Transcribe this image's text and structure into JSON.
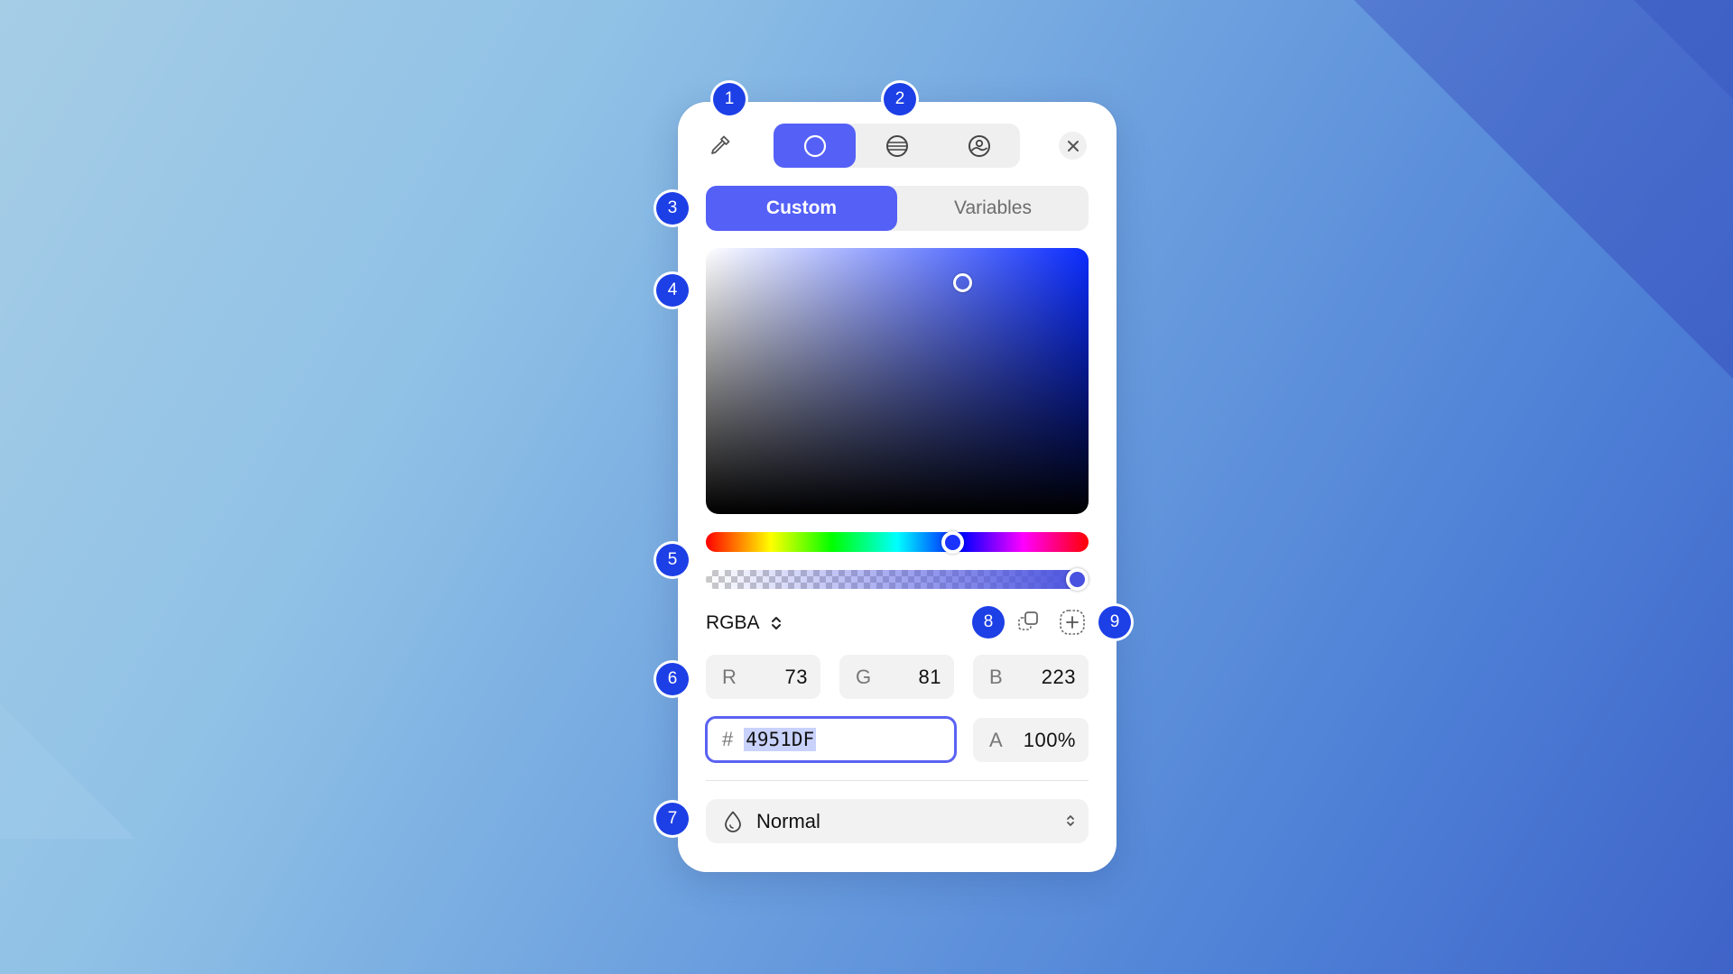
{
  "top_bar": {
    "modes": [
      "solid-color",
      "linear-gradient",
      "image-fill"
    ],
    "active_mode": "solid-color"
  },
  "tabs": {
    "custom": "Custom",
    "variables": "Variables",
    "active": "Custom"
  },
  "color": {
    "hex_color": "#4951DF",
    "hue_color": "#1B33FF",
    "format": "RGBA",
    "r_label": "R",
    "r_value": "73",
    "g_label": "G",
    "g_value": "81",
    "b_label": "B",
    "b_value": "223",
    "hex_prefix": "#",
    "hex": "4951DF",
    "a_label": "A",
    "a_value": "100%",
    "alpha_level": 1.0
  },
  "blend": {
    "mode": "Normal"
  },
  "badges": [
    "1",
    "2",
    "3",
    "4",
    "5",
    "6",
    "7",
    "8",
    "9"
  ],
  "accent": "#5460F6",
  "badge_color": "#1D3FE6"
}
